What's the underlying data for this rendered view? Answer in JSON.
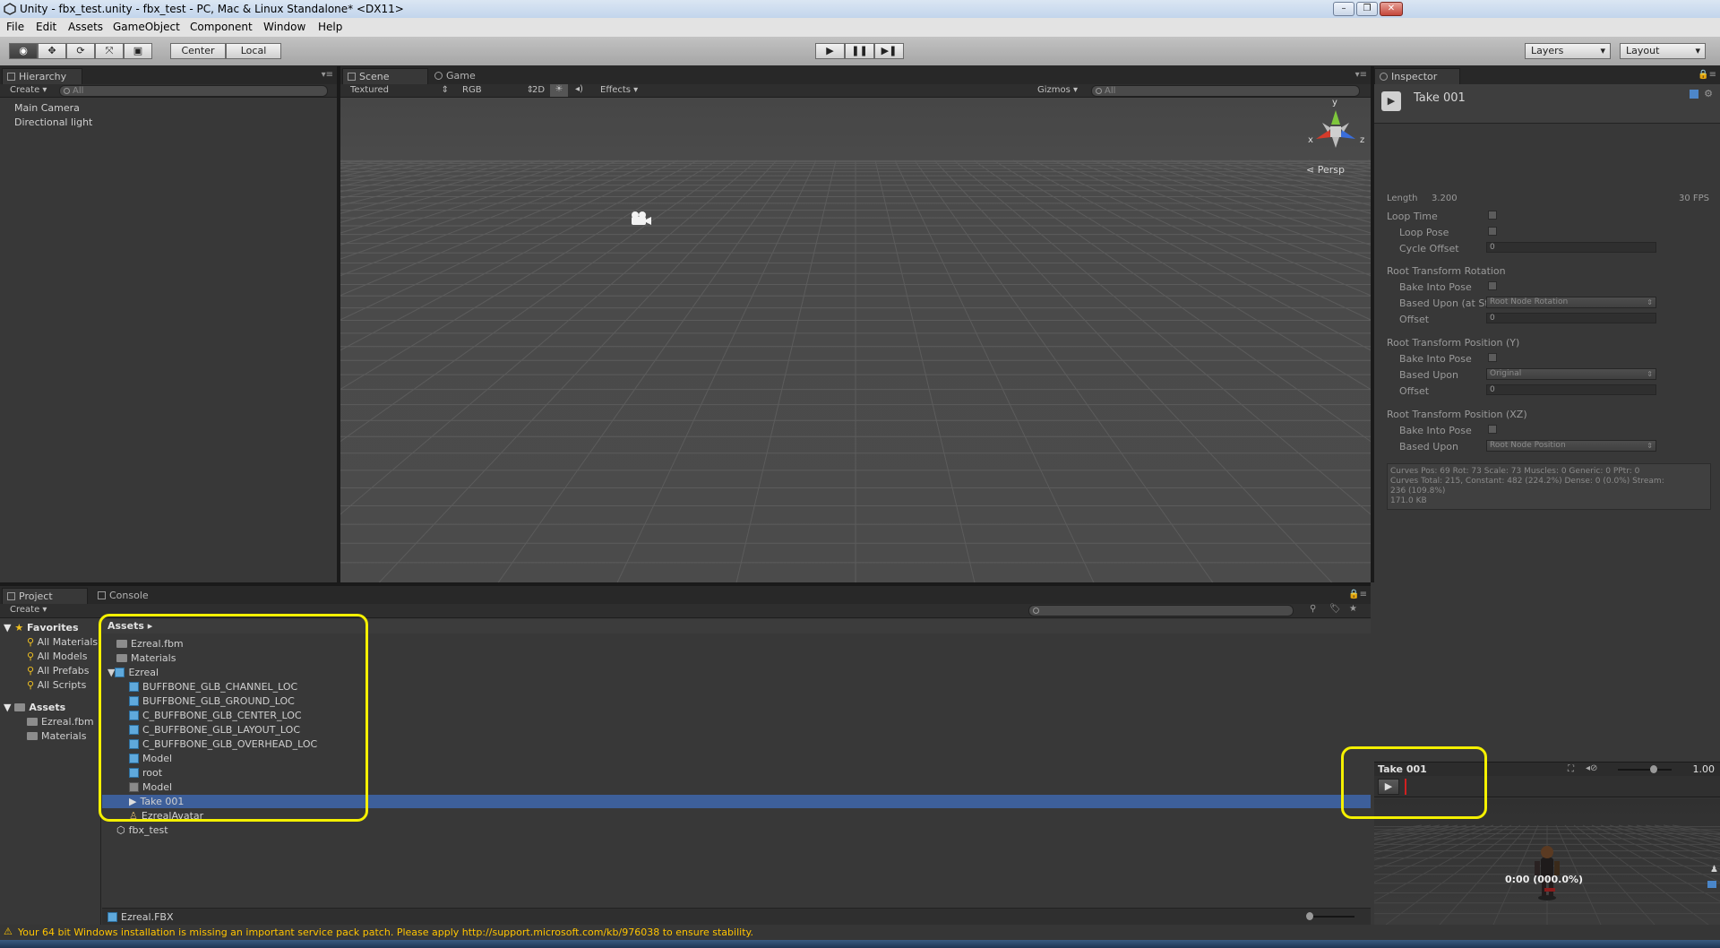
{
  "window": {
    "title": "Unity - fbx_test.unity - fbx_test - PC, Mac & Linux Standalone* <DX11>"
  },
  "menu": [
    "File",
    "Edit",
    "Assets",
    "GameObject",
    "Component",
    "Window",
    "Help"
  ],
  "toolbar": {
    "pivot": "Center",
    "space": "Local",
    "layers": "Layers",
    "layout": "Layout"
  },
  "hierarchy": {
    "tab": "Hierarchy",
    "create": "Create",
    "search_placeholder": "All",
    "items": [
      "Main Camera",
      "Directional light"
    ]
  },
  "scene": {
    "tab_scene": "Scene",
    "tab_game": "Game",
    "shading": "Textured",
    "render": "RGB",
    "mode2d": "2D",
    "effects": "Effects",
    "gizmos": "Gizmos",
    "search_placeholder": "All",
    "persp": "Persp",
    "axis_x": "x",
    "axis_y": "y",
    "axis_z": "z"
  },
  "inspector": {
    "tab": "Inspector",
    "asset_name": "Take 001",
    "length_label": "Length",
    "length_value": "3.200",
    "fps": "30 FPS",
    "loop_time": "Loop Time",
    "loop_pose": "Loop Pose",
    "cycle_offset": "Cycle Offset",
    "cycle_offset_value": "0",
    "rt_rotation": "Root Transform Rotation",
    "bake_into_pose": "Bake Into Pose",
    "based_upon_start": "Based Upon (at Star",
    "rot_based_value": "Root Node Rotation",
    "offset": "Offset",
    "rot_offset_value": "0",
    "rt_position_y": "Root Transform Position (Y)",
    "based_upon": "Based Upon",
    "posy_based_value": "Original",
    "posy_offset_value": "0",
    "rt_position_xz": "Root Transform Position (XZ)",
    "posxz_based_value": "Root Node Position",
    "curves_line1": "Curves Pos: 69 Rot: 73 Scale: 73 Muscles: 0 Generic: 0 PPtr: 0",
    "curves_line2": "Curves Total: 215, Constant: 482 (224.2%) Dense: 0 (0.0%) Stream:",
    "curves_line3": "236 (109.8%)",
    "curves_line4": "171.0 KB"
  },
  "preview": {
    "clip_name": "Take 001",
    "speed": "1.00",
    "time": "0:00 (000.0%)"
  },
  "project": {
    "tab_project": "Project",
    "tab_console": "Console",
    "create": "Create",
    "favorites_label": "Favorites",
    "favorites": [
      "All Materials",
      "All Models",
      "All Prefabs",
      "All Scripts"
    ],
    "assets_label": "Assets",
    "assets_tree": [
      "Ezreal.fbm",
      "Materials"
    ],
    "breadcrumb": "Assets",
    "files": [
      {
        "name": "Ezreal.fbm",
        "kind": "folder"
      },
      {
        "name": "Materials",
        "kind": "folder"
      },
      {
        "name": "Ezreal",
        "kind": "model"
      },
      {
        "name": "BUFFBONE_GLB_CHANNEL_LOC",
        "kind": "mesh"
      },
      {
        "name": "BUFFBONE_GLB_GROUND_LOC",
        "kind": "mesh"
      },
      {
        "name": "C_BUFFBONE_GLB_CENTER_LOC",
        "kind": "mesh"
      },
      {
        "name": "C_BUFFBONE_GLB_LAYOUT_LOC",
        "kind": "mesh"
      },
      {
        "name": "C_BUFFBONE_GLB_OVERHEAD_LOC",
        "kind": "mesh"
      },
      {
        "name": "Model",
        "kind": "mesh"
      },
      {
        "name": "root",
        "kind": "mesh"
      },
      {
        "name": "Model",
        "kind": "grid"
      },
      {
        "name": "Take 001",
        "kind": "anim"
      },
      {
        "name": "EzrealAvatar",
        "kind": "avatar"
      },
      {
        "name": "fbx_test",
        "kind": "scene"
      }
    ],
    "selected_file": "Ezreal.FBX"
  },
  "status": {
    "message": "Your 64 bit Windows installation is missing an important service pack patch. Please apply http://support.microsoft.com/kb/976038 to ensure stability."
  },
  "colors": {
    "highlight": "#f4f000",
    "selection": "#3d5f9a",
    "warning": "#ffc400"
  }
}
